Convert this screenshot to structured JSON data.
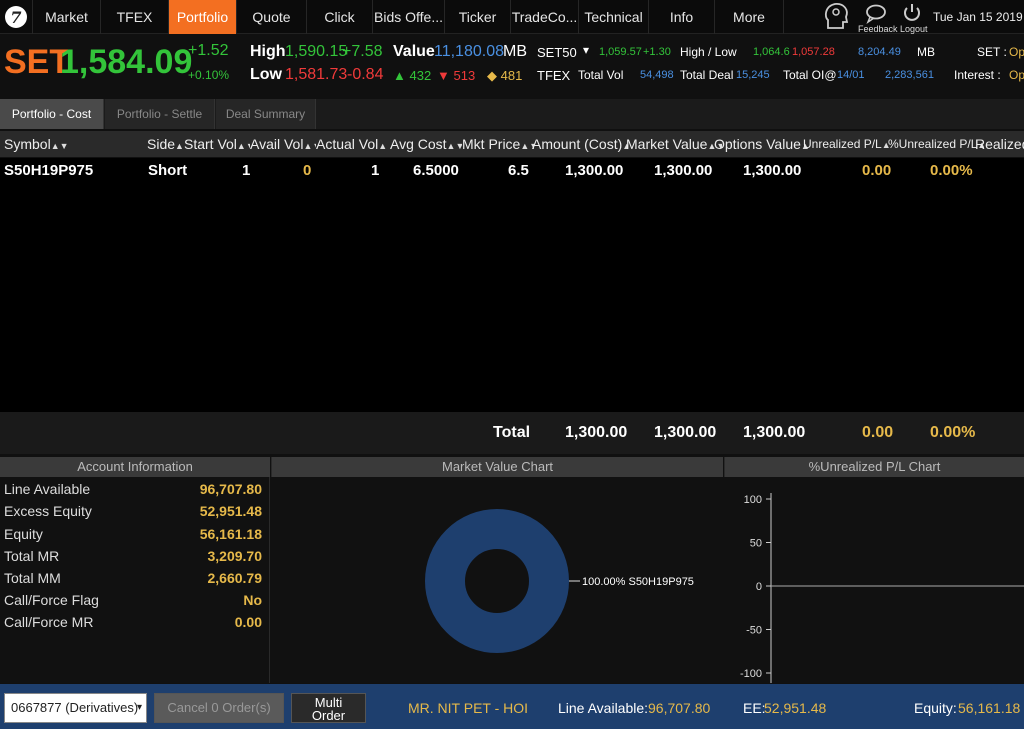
{
  "nav": {
    "tabs": [
      {
        "label": "Market",
        "active": false
      },
      {
        "label": "TFEX",
        "active": false
      },
      {
        "label": "Portfolio",
        "active": true
      },
      {
        "label": "Quote",
        "active": false
      },
      {
        "label": "Click",
        "active": false
      },
      {
        "label": "Bids Offe...",
        "active": false
      },
      {
        "label": "Ticker",
        "active": false
      },
      {
        "label": "TradeCo...",
        "active": false
      },
      {
        "label": "Technical",
        "active": false
      },
      {
        "label": "Info",
        "active": false
      },
      {
        "label": "More",
        "active": false
      }
    ],
    "feedback_label": "Feedback",
    "logout_label": "Logout",
    "datetime": "Tue Jan 15 2019"
  },
  "index": {
    "name": "SET",
    "value": "1,584.09",
    "change": "+1.52",
    "change_pct": "+0.10%",
    "high_label": "High",
    "high_value": "1,590.15",
    "high_change": "+7.58",
    "low_label": "Low",
    "low_value": "1,581.73",
    "low_change": "-0.84",
    "value_label": "Value",
    "value_amount": "11,180.08",
    "value_unit": "MB",
    "adv_up": "432",
    "adv_down": "513",
    "adv_unch": "481",
    "set50_label": "SET50",
    "set50_value": "1,059.57",
    "set50_change": "+1.30",
    "highlow_label": "High / Low",
    "set50_high": "1,064.6",
    "set50_low": "1,057.28",
    "set50_vol": "8,204.49",
    "set50_unit": "MB",
    "set_label": "SET :",
    "set_val": "Op",
    "tfex_label": "TFEX",
    "totalvol_label": "Total Vol",
    "totalvol": "54,498",
    "totaldeal_label": "Total Deal",
    "totaldeal": "15,245",
    "totaloi_label": "Total OI@",
    "totaloi_date": "14/01",
    "totaloi": "2,283,561",
    "interest_label": "Interest :",
    "interest_val": "Op"
  },
  "subtabs": [
    {
      "label": "Portfolio - Cost",
      "active": true
    },
    {
      "label": "Portfolio - Settle",
      "active": false
    },
    {
      "label": "Deal Summary",
      "active": false
    }
  ],
  "table": {
    "headers": [
      "Symbol",
      "Side",
      "Start Vol",
      "Avail Vol",
      "Actual Vol",
      "Avg Cost",
      "Mkt Price",
      "Amount (Cost)",
      "Market Value",
      "Options Value",
      "Unrealized P/L",
      "%Unrealized P/L",
      "Realized"
    ],
    "rows": [
      {
        "symbol": "S50H19P975",
        "side": "Short",
        "start_vol": "1",
        "avail_vol": "0",
        "actual_vol": "1",
        "avg_cost": "6.5000",
        "mkt_price": "6.5",
        "amount_cost": "1,300.00",
        "market_value": "1,300.00",
        "options_value": "1,300.00",
        "unrealized": "0.00",
        "unrealized_pct": "0.00%"
      }
    ],
    "total": {
      "label": "Total",
      "amount_cost": "1,300.00",
      "market_value": "1,300.00",
      "options_value": "1,300.00",
      "unrealized": "0.00",
      "unrealized_pct": "0.00%"
    }
  },
  "account": {
    "title": "Account Information",
    "items": [
      {
        "label": "Line Available",
        "value": "96,707.80"
      },
      {
        "label": "Excess Equity",
        "value": "52,951.48"
      },
      {
        "label": "Equity",
        "value": "56,161.18"
      },
      {
        "label": "Total MR",
        "value": "3,209.70"
      },
      {
        "label": "Total MM",
        "value": "2,660.79"
      },
      {
        "label": "Call/Force Flag",
        "value": "No"
      },
      {
        "label": "Call/Force MR",
        "value": "0.00"
      }
    ]
  },
  "mv_chart_title": "Market Value Chart",
  "pl_chart_title": "%Unrealized P/L Chart",
  "chart_data": [
    {
      "type": "pie",
      "title": "Market Value Chart",
      "labels": [
        "S50H19P975"
      ],
      "values": [
        100.0
      ],
      "slice_labels": [
        "100.00% S50H19P975"
      ],
      "colors": [
        "#1e3f6e"
      ]
    },
    {
      "type": "bar",
      "title": "%Unrealized P/L Chart",
      "categories": [],
      "values": [],
      "ylim": [
        -100,
        100
      ],
      "yticks": [
        "100",
        "50",
        "0",
        "-50",
        "-100"
      ]
    }
  ],
  "status": {
    "account_select": "0667877 (Derivatives)",
    "cancel_label": "Cancel 0 Order(s)",
    "multi_order_label": "Multi Order",
    "user_name": "MR. NIT PET - HOI",
    "line_available_label": "Line Available:",
    "line_available": "96,707.80",
    "ee_label": "EE:",
    "ee": "52,951.48",
    "equity_label": "Equity:",
    "equity": "56,161.18"
  },
  "colors": {
    "accent": "#f36f21",
    "up": "#33c43a",
    "down": "#f03a3a",
    "highlight": "#e6b94a",
    "blue": "#4a90e2",
    "status_bar": "#1e3f6e"
  }
}
